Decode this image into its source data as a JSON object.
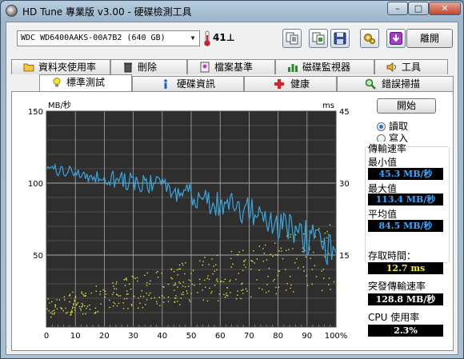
{
  "window": {
    "title": "HD Tune 專業版 v3.00 - 硬碟檢測工具",
    "controls": {
      "minimize": "–",
      "maximize": "□",
      "close": "✕"
    }
  },
  "toolbar": {
    "drive": "WDC WD6400AAKS-00A7B2 (640 GB)",
    "temperature": "41",
    "temperature_unit": "⊥",
    "exit_label": "離開",
    "buttons": [
      "copy-text-icon",
      "copy-screenshot-icon",
      "save-icon",
      "options-icon",
      "download-icon"
    ]
  },
  "tabs_row1": [
    {
      "label": "資料夾使用率",
      "icon": "folder-icon"
    },
    {
      "label": "刪除",
      "icon": "trash-icon"
    },
    {
      "label": "檔案基準",
      "icon": "file-benchmark-icon"
    },
    {
      "label": "磁碟監視器",
      "icon": "disk-monitor-icon"
    },
    {
      "label": "工具",
      "icon": "speaker-icon"
    }
  ],
  "tabs_row2": [
    {
      "label": "標準測試",
      "icon": "benchmark-bulb-icon",
      "active": true
    },
    {
      "label": "硬碟資訊",
      "icon": "info-icon"
    },
    {
      "label": "健康",
      "icon": "health-cross-icon"
    },
    {
      "label": "錯誤掃描",
      "icon": "magnifier-icon"
    }
  ],
  "controls": {
    "start_label": "開始",
    "read_label": "讀取",
    "write_label": "寫入",
    "mode_selected": "read"
  },
  "stats": {
    "transfer_rate_label": "傳輸速率",
    "min_label": "最小值",
    "min_value": "45.3 MB/秒",
    "max_label": "最大值",
    "max_value": "113.4 MB/秒",
    "avg_label": "平均值",
    "avg_value": "84.5 MB/秒",
    "access_time_label": "存取時間：",
    "access_time_value": "12.7 ms",
    "burst_rate_label": "突發傳輸速率",
    "burst_rate_value": "128.8 MB/秒",
    "cpu_label": "CPU 使用率",
    "cpu_value": "2.3%"
  },
  "colors": {
    "transfer_line": "#39a6de",
    "access_dots": "#e2e23a",
    "plot_background": "#2e2e2e",
    "grid": "#b8b8b8"
  },
  "chart_data": {
    "type": "line",
    "left_unit": "MB/秒",
    "right_unit": "ms",
    "x_ticks": [
      "0",
      "10",
      "20",
      "30",
      "40",
      "50",
      "60",
      "70",
      "80",
      "90",
      "100%"
    ],
    "y_ticks_left": [
      "150",
      "100",
      "50"
    ],
    "y_ticks_right": [
      "45",
      "30",
      "15"
    ],
    "xlim": [
      0,
      100
    ],
    "ylim_left": [
      0,
      150
    ],
    "ylim_right": [
      0,
      45
    ],
    "grid": true,
    "series": [
      {
        "name": "傳輸速率",
        "axis": "left",
        "x": [
          0,
          2.5,
          5,
          7.5,
          10,
          12.5,
          15,
          17.5,
          20,
          22.5,
          25,
          27.5,
          30,
          32.5,
          35,
          37.5,
          40,
          42.5,
          45,
          47.5,
          50,
          52.5,
          55,
          57.5,
          60,
          62.5,
          65,
          67.5,
          70,
          72.5,
          75,
          77.5,
          80,
          82.5,
          85,
          87.5,
          90,
          92.5,
          95,
          97.5,
          100
        ],
        "values": [
          110,
          109,
          108,
          108,
          107,
          106,
          106,
          105,
          104,
          103,
          103,
          102,
          101,
          100,
          99,
          98,
          96,
          95,
          94,
          92,
          91,
          90,
          88,
          86,
          85,
          84,
          83,
          81,
          80,
          79,
          76,
          74,
          72,
          70,
          68,
          65,
          62,
          60,
          57,
          54,
          51
        ]
      },
      {
        "name": "存取時間",
        "axis": "right",
        "type": "scatter",
        "x_range": [
          0,
          100
        ],
        "values_range_ms": [
          2,
          24
        ],
        "average_ms": 12.7
      }
    ]
  }
}
